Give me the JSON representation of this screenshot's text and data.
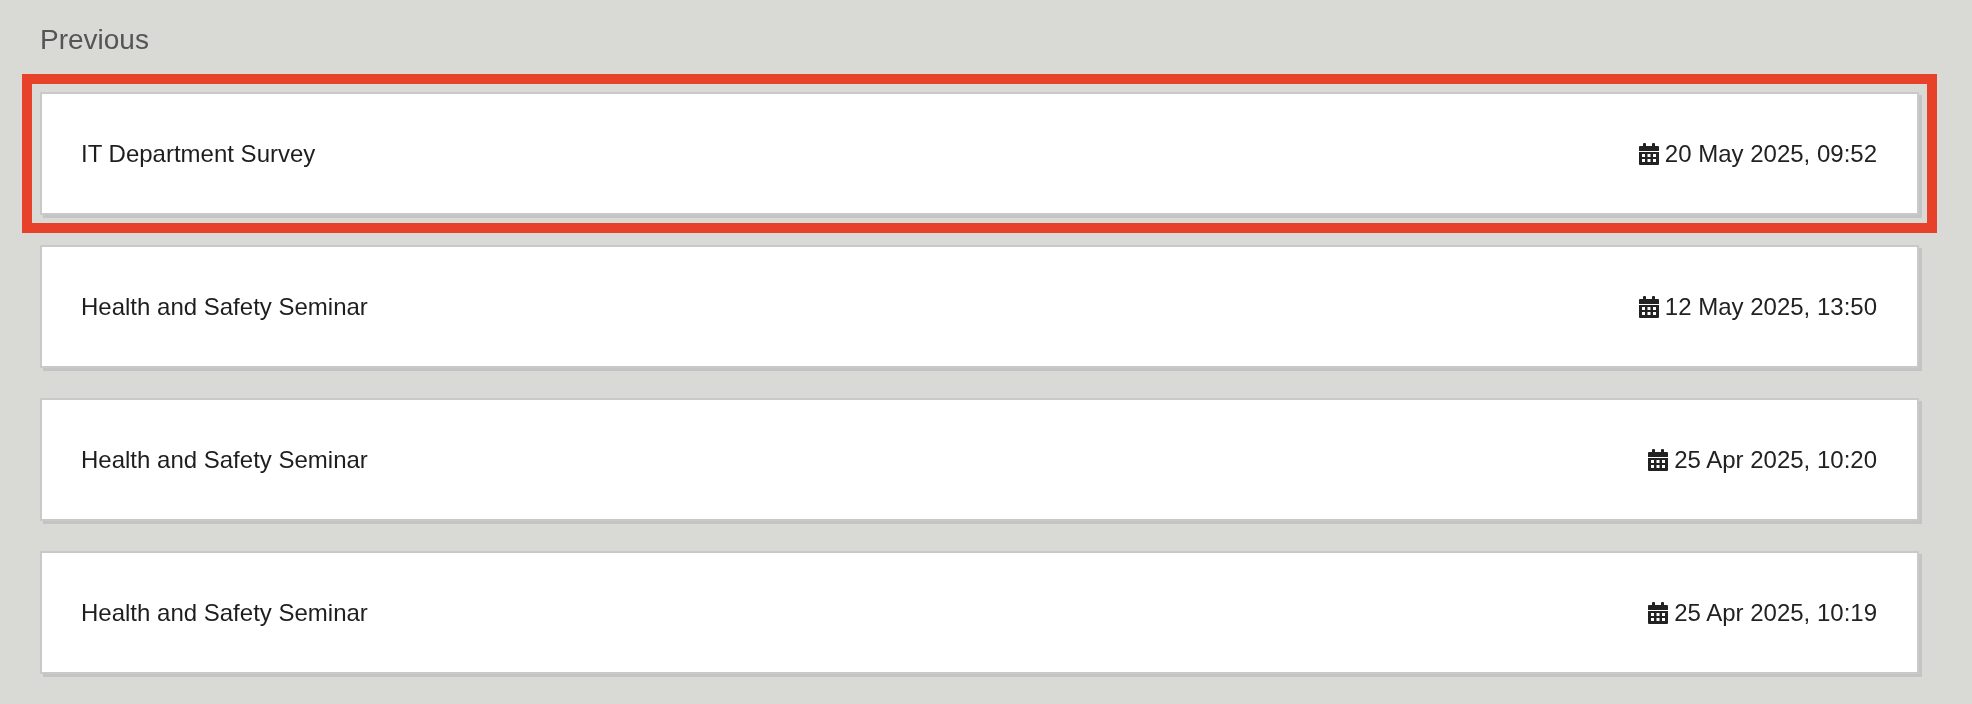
{
  "section": {
    "title": "Previous"
  },
  "items": [
    {
      "title": "IT Department Survey",
      "date": "20 May 2025, 09:52",
      "selected": true
    },
    {
      "title": "Health and Safety Seminar",
      "date": "12 May 2025, 13:50",
      "selected": false
    },
    {
      "title": "Health and Safety Seminar",
      "date": "25 Apr 2025, 10:20",
      "selected": false
    },
    {
      "title": "Health and Safety Seminar",
      "date": "25 Apr 2025, 10:19",
      "selected": false
    }
  ]
}
